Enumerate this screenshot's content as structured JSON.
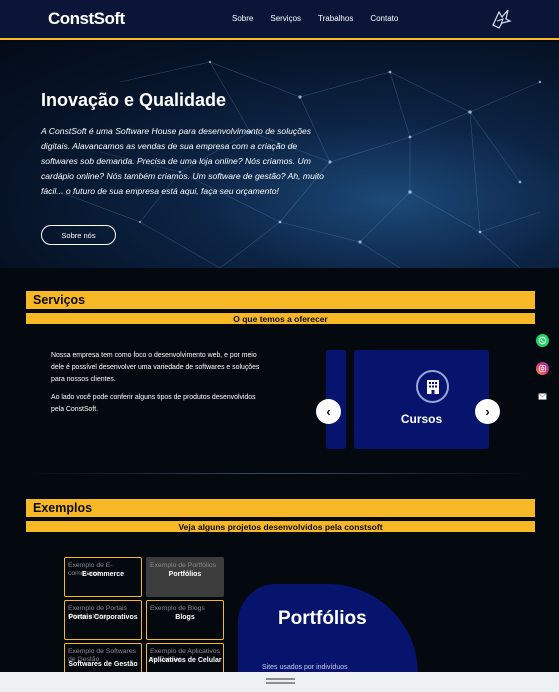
{
  "brand": {
    "logo": "ConstSoft"
  },
  "nav": {
    "items": [
      "Sobre",
      "Serviços",
      "Trabalhos",
      "Contato"
    ]
  },
  "hero": {
    "title": "Inovação e Qualidade",
    "text": "A ConstSoft é uma Software House para desenvolvimento de soluções digitais. Alavancamos as vendas de sua empresa com a criação de softwares sob demanda. Precisa de uma loja online? Nós criamos. Um cardápio online? Nós também criamos. Um software de gestão? Ah, muito fácil... o futuro de sua empresa está aqui, faça seu orçamento!",
    "button": "Sobre nós"
  },
  "services": {
    "title": "Serviços",
    "subtitle": "O que temos a oferecer",
    "paragraph1": "Nossa empresa tem como foco o desenvolvimento web, e por meio dele é possível desenvolver uma variedade de softwares e soluções para nossos clientes.",
    "paragraph2": "Ao lado você pode conferir alguns tipos de produtos desenvolvidos pela ConstSoft.",
    "card_label": "Cursos",
    "prev": "‹",
    "next": "›"
  },
  "examples": {
    "title": "Exemplos",
    "subtitle": "Veja alguns projetos desenvolvidos pela constsoft",
    "tiles": [
      {
        "alt": "Exemplo de E-commerce",
        "title": "E-commerce"
      },
      {
        "alt": "Exemplo de Portfólios",
        "title": "Portfólios"
      },
      {
        "alt": "Exemplo de Portais Corporativos",
        "title": "Portais Corporativos"
      },
      {
        "alt": "Exemplo de Blogs",
        "title": "Blogs"
      },
      {
        "alt": "Exemplo de Softwares de Gestão",
        "title": "Softwares de Gestão"
      },
      {
        "alt": "Exemplo de Aplicativos de Celular",
        "title": "Aplicativos de Celular"
      }
    ],
    "panel_title": "Portfólios",
    "panel_text": "Sites usados por indivíduos"
  },
  "colors": {
    "accent": "#f6b825",
    "navy": "#07146e",
    "nav_bg": "#0a1538",
    "page_bg": "#04090f"
  },
  "social_icons": [
    "whatsapp-icon",
    "instagram-icon",
    "email-icon"
  ]
}
